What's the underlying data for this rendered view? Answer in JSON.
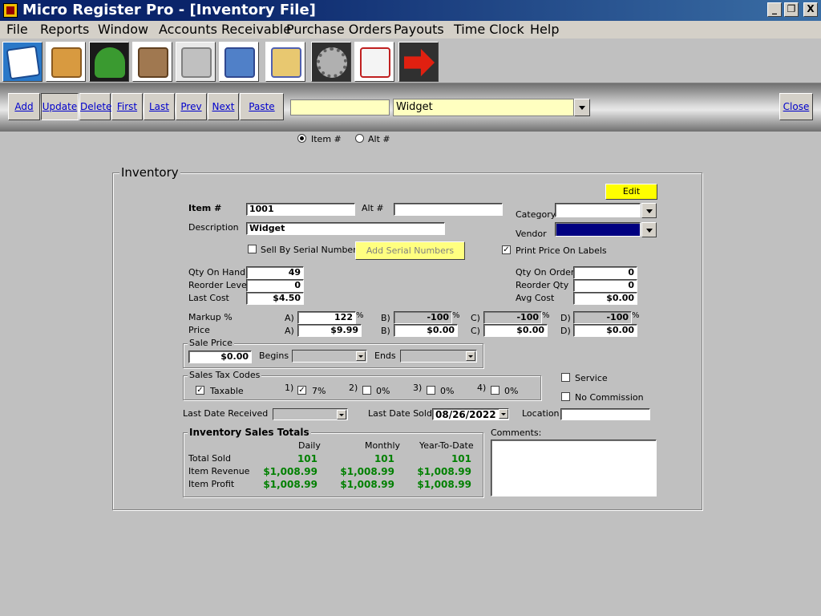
{
  "window": {
    "title": "Micro Register Pro - [Inventory File]",
    "minimize_glyph": "_",
    "restore_glyph": "❐",
    "close_glyph": "X"
  },
  "menu": [
    "File",
    "Reports",
    "Window",
    "Accounts Receivable",
    "Purchase Orders",
    "Payouts",
    "Time Clock",
    "Help"
  ],
  "toolbar_icons": [
    "notepad-pen-icon",
    "clipboard-box-icon",
    "people-group-icon",
    "clipboard-person-icon",
    "cash-register-icon",
    "warehouse-delivery-icon",
    "checklist-dollar-icon",
    "gear-icon",
    "paid-invoice-icon",
    "exit-arrow-icon"
  ],
  "nav": {
    "buttons": [
      "Add",
      "Update",
      "Delete",
      "First",
      "Last",
      "Prev",
      "Next",
      "Paste"
    ],
    "search_value": "",
    "lookup_value": "Widget",
    "close_label": "Close",
    "radio_item": "Item #",
    "radio_alt": "Alt #"
  },
  "form": {
    "group_title": "Inventory",
    "edit_label": "Edit",
    "item_label": "Item #",
    "item_value": "1001",
    "alt_label": "Alt #",
    "alt_value": "",
    "description_label": "Description",
    "description_value": "Widget",
    "category_label": "Category",
    "vendor_label": "Vendor",
    "sell_serial_label": "Sell By Serial Numbers",
    "add_serial_label": "Add Serial Numbers",
    "print_price_label": "Print Price On Labels",
    "qty_on_hand_label": "Qty On Hand",
    "qty_on_hand": "49",
    "reorder_level_label": "Reorder Level",
    "reorder_level": "0",
    "last_cost_label": "Last Cost",
    "last_cost": "$4.50",
    "qty_on_order_label": "Qty On Order",
    "qty_on_order": "0",
    "reorder_qty_label": "Reorder Qty",
    "reorder_qty": "0",
    "avg_cost_label": "Avg Cost",
    "avg_cost": "$0.00",
    "markup_label": "Markup %",
    "price_label": "Price",
    "tiers": [
      {
        "letter": "A)",
        "markup": "122",
        "price": "$9.99"
      },
      {
        "letter": "B)",
        "markup": "-100",
        "price": "$0.00"
      },
      {
        "letter": "C)",
        "markup": "-100",
        "price": "$0.00"
      },
      {
        "letter": "D)",
        "markup": "-100",
        "price": "$0.00"
      }
    ],
    "percent_sign": "%",
    "sale_price_title": "Sale Price",
    "sale_price": "$0.00",
    "begins_label": "Begins",
    "ends_label": "Ends",
    "tax_title": "Sales Tax Codes",
    "taxable_label": "Taxable",
    "tax_codes": [
      {
        "num": "1)",
        "rate": "7%",
        "checked": true
      },
      {
        "num": "2)",
        "rate": "0%",
        "checked": false
      },
      {
        "num": "3)",
        "rate": "0%",
        "checked": false
      },
      {
        "num": "4)",
        "rate": "0%",
        "checked": false
      }
    ],
    "service_label": "Service",
    "no_commission_label": "No Commission",
    "last_received_label": "Last Date Received",
    "last_sold_label": "Last Date Sold",
    "last_sold_value": "08/26/2022",
    "location_label": "Location",
    "location_value": "",
    "comments_label": "Comments:",
    "totals_title": "Inventory Sales Totals",
    "totals_cols": [
      "Daily",
      "Monthly",
      "Year-To-Date"
    ],
    "totals_rows": [
      {
        "label": "Total Sold",
        "values": [
          "101",
          "101",
          "101"
        ]
      },
      {
        "label": "Item Revenue",
        "values": [
          "$1,008.99",
          "$1,008.99",
          "$1,008.99"
        ]
      },
      {
        "label": "Item Profit",
        "values": [
          "$1,008.99",
          "$1,008.99",
          "$1,008.99"
        ]
      }
    ]
  },
  "colors": {
    "title_bar": "#0a246a",
    "lookup_bg": "#ffffc0",
    "edit_bg": "#ffff00",
    "totals_green": "#008000",
    "vendor_bg": "#000080",
    "nav_link": "#0000cc"
  }
}
